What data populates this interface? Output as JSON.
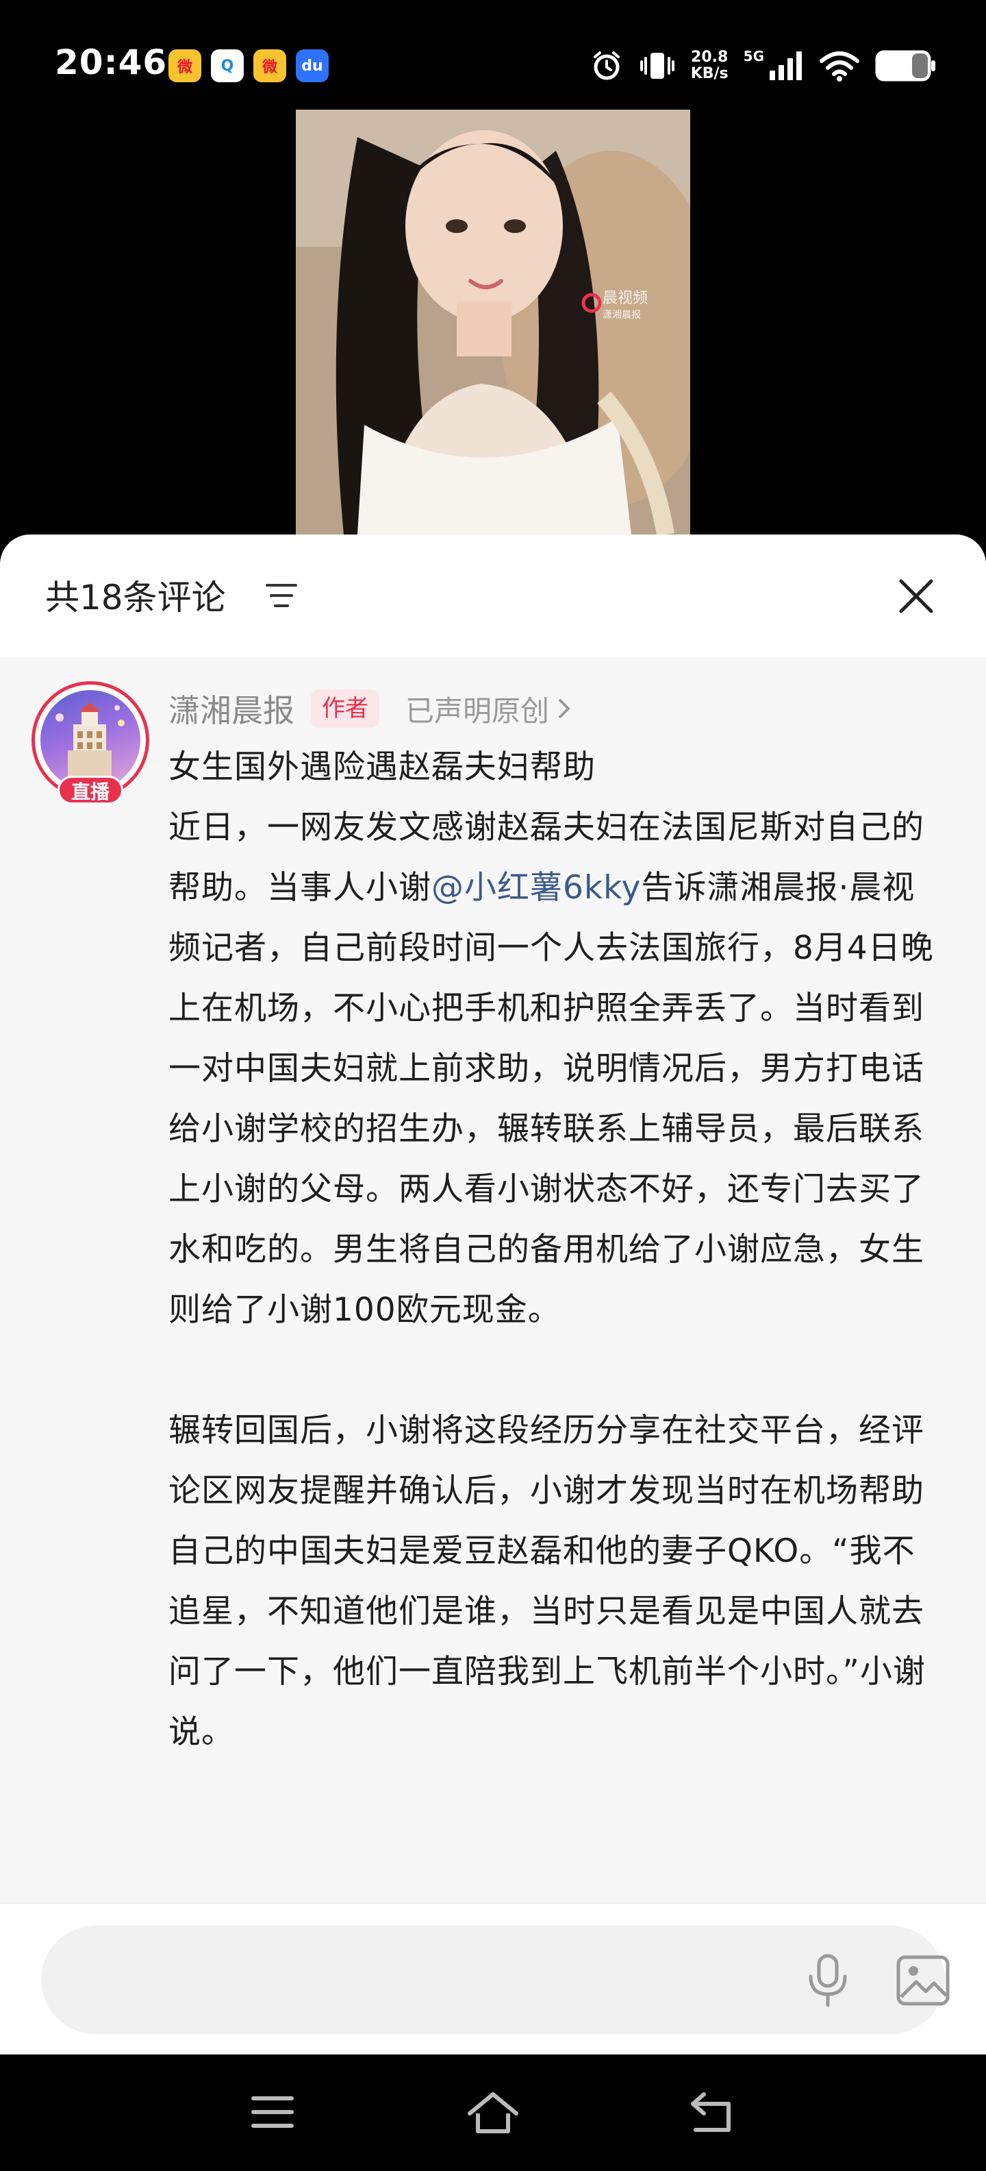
{
  "status_bar": {
    "time": "20:46",
    "notifications": [
      {
        "icon": "weibo-icon",
        "glyph": "微"
      },
      {
        "icon": "qq-browser-icon",
        "glyph": "Q"
      },
      {
        "icon": "weibo-icon",
        "glyph": "微"
      },
      {
        "icon": "baidu-icon",
        "glyph": "du"
      }
    ],
    "net_speed_value": "20.8",
    "net_speed_unit": "KB/s",
    "signal_label": "5G",
    "icons": [
      "alarm-icon",
      "vibrate-icon",
      "signal-icon",
      "wifi-icon",
      "battery-icon"
    ]
  },
  "video": {
    "watermark": "晨视频",
    "watermark_sub": "潇湘晨报"
  },
  "comments_panel": {
    "title": "共18条评论",
    "filter_icon": "filter-icon",
    "close_icon": "close-icon"
  },
  "comment": {
    "author": "潇湘晨报",
    "author_tag": "作者",
    "original_label": "已声明原创",
    "avatar_badge": "直播",
    "headline": "女生国外遇险遇赵磊夫妇帮助",
    "p1_before": "近日，一网友发文感谢赵磊夫妇在法国尼斯对自己的帮助。当事人小谢",
    "mention": "@小红薯6kky",
    "p1_after": "告诉潇湘晨报·晨视频记者，自己前段时间一个人去法国旅行，8月4日晚上在机场，不小心把手机和护照全弄丢了。当时看到一对中国夫妇就上前求助，说明情况后，男方打电话给小谢学校的招生办，辗转联系上辅导员，最后联系上小谢的父母。两人看小谢状态不好，还专门去买了水和吃的。男生将自己的备用机给了小谢应急，女生则给了小谢100欧元现金。",
    "p2": "辗转回国后，小谢将这段经历分享在社交平台，经评论区网友提醒并确认后，小谢才发现当时在机场帮助自己的中国夫妇是爱豆赵磊和他的妻子QKO。“我不追星，不知道他们是谁，当时只是看见是中国人就去问了一下，他们一直陪我到上飞机前半个小时。”小谢说。"
  },
  "input_bar": {
    "placeholder": "",
    "mic_icon": "microphone-icon",
    "image_icon": "image-icon"
  },
  "nav_bar": {
    "buttons": [
      "menu-icon",
      "home-icon",
      "back-icon"
    ]
  },
  "colors": {
    "accent": "#e8314e",
    "mention": "#3b5a8a",
    "sheet_bg": "#f7f7f7"
  }
}
